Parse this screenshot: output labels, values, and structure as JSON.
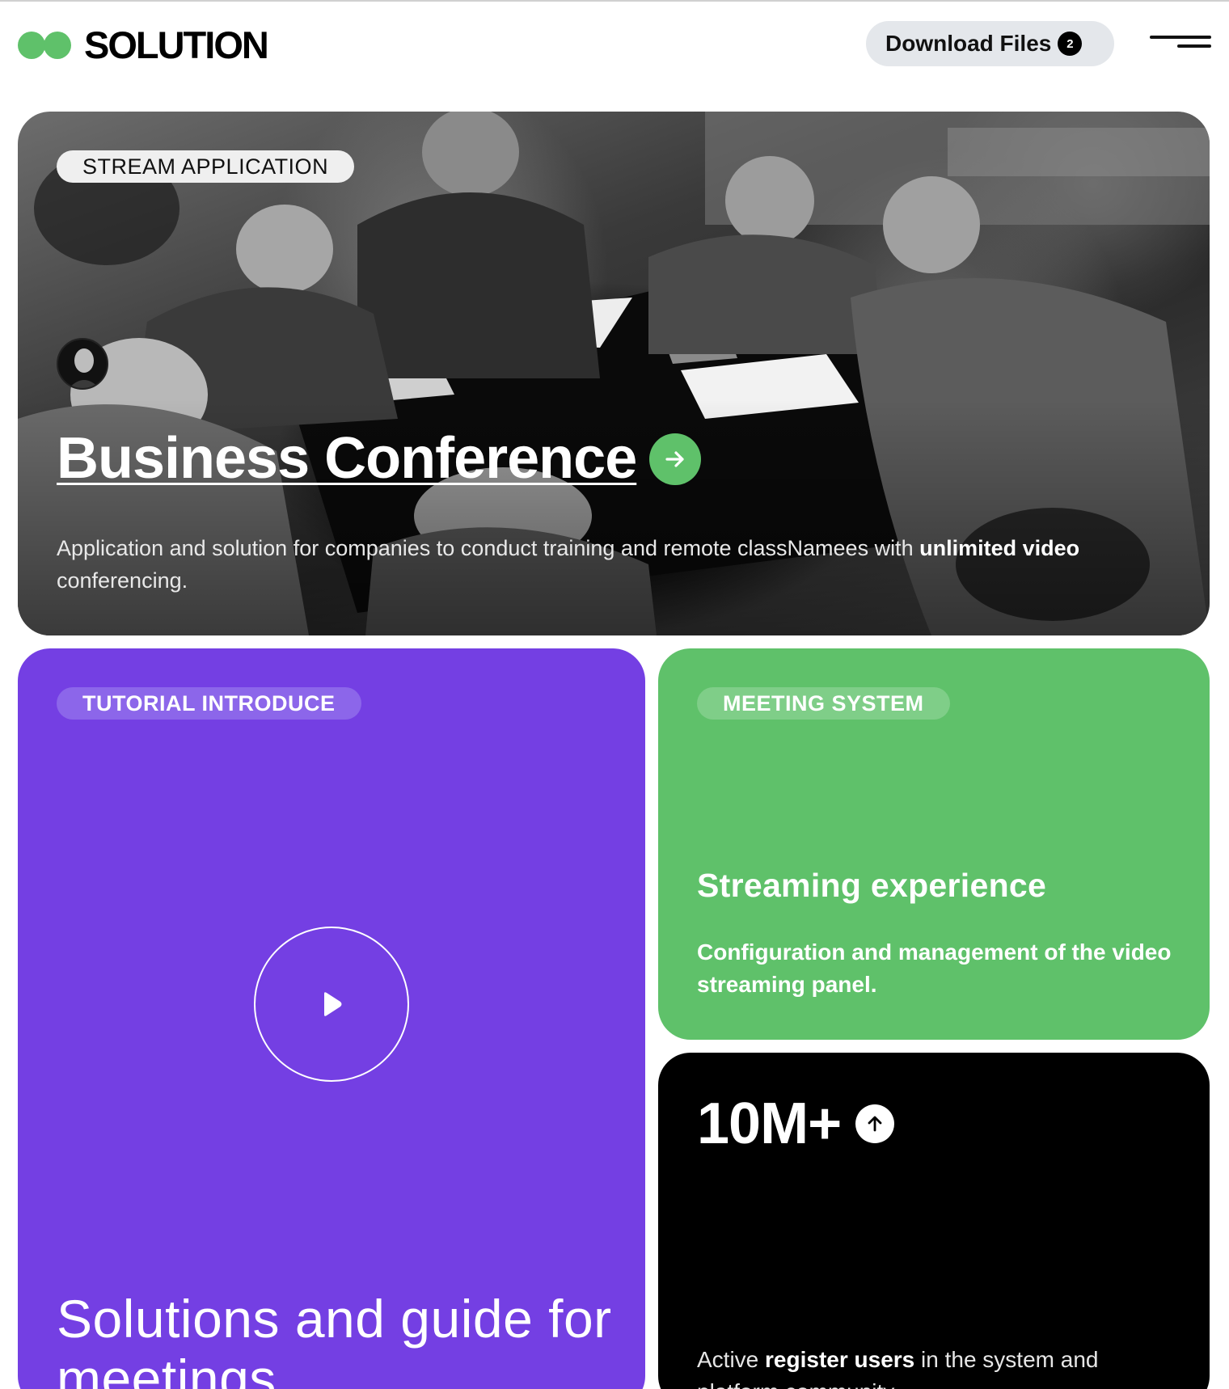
{
  "brand": {
    "name": "SOLUTION",
    "accent": "#5fc16a"
  },
  "header": {
    "download_label": "Download Files",
    "download_count": "2",
    "menu_icon": "hamburger-menu-icon"
  },
  "hero": {
    "tag": "STREAM APPLICATION",
    "title": "Business Conference",
    "desc_part1": "Application and solution for companies to conduct training and remote classNamees with ",
    "desc_bold": "unlimited video",
    "desc_part2": " conferencing.",
    "arrow_icon": "arrow-right-icon",
    "image": "black-and-white photo of businessmen meeting around a table"
  },
  "tutorial": {
    "tag": "TUTORIAL INTRODUCE",
    "title": "Solutions and guide for meetings",
    "color": "#743fe3",
    "play_icon": "play-icon"
  },
  "meeting": {
    "tag": "MEETING SYSTEM",
    "title": "Streaming experience",
    "desc": "Configuration and management of the video streaming panel.",
    "color": "#5fc16a"
  },
  "stats": {
    "value": "10M+",
    "arrow_icon": "arrow-up-icon",
    "desc_part1": "Active ",
    "desc_bold": "register users",
    "desc_part2": " in the system and platform community."
  }
}
